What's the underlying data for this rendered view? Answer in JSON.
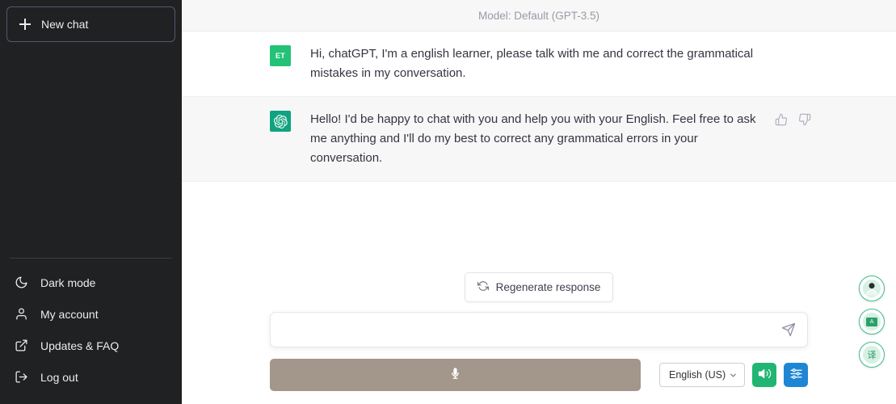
{
  "sidebar": {
    "new_chat_label": "New chat",
    "items": [
      {
        "label": "Dark mode",
        "icon": "moon-icon"
      },
      {
        "label": "My account",
        "icon": "person-icon"
      },
      {
        "label": "Updates & FAQ",
        "icon": "external-link-icon"
      },
      {
        "label": "Log out",
        "icon": "logout-icon"
      }
    ]
  },
  "header": {
    "model_label": "Model: Default (GPT-3.5)"
  },
  "messages": [
    {
      "role": "user",
      "avatar_initials": "ET",
      "avatar_color": "#24c277",
      "text": "Hi, chatGPT, I'm a english learner, please talk with me and correct the grammatical mistakes in my conversation."
    },
    {
      "role": "assistant",
      "avatar_initials": "",
      "avatar_color": "#10a37f",
      "text": "Hello! I'd be happy to chat with you and help you with your English. Feel free to ask me anything and I'll do my best to correct any grammatical errors in your conversation."
    }
  ],
  "message_actions": {
    "thumbs_up": "thumbs-up-icon",
    "thumbs_down": "thumbs-down-icon"
  },
  "composer": {
    "regenerate_label": "Regenerate response",
    "input_value": "",
    "input_placeholder": "",
    "send_icon": "send-icon",
    "mic_icon": "microphone-icon",
    "language_selected": "English (US)",
    "speaker_icon": "speaker-icon",
    "settings_icon": "sliders-icon"
  },
  "floating_buttons": [
    {
      "name": "avatar-assistant",
      "glyph": ""
    },
    {
      "name": "flashcard",
      "glyph": "A"
    },
    {
      "name": "translate",
      "glyph": "译"
    }
  ],
  "colors": {
    "sidebar_bg": "#202123",
    "assistant_bg": "#f7f7f8",
    "brand_green": "#10a37f",
    "mic_taupe": "#a3968a",
    "speaker_green": "#21b573",
    "settings_blue": "#1f86d4"
  }
}
